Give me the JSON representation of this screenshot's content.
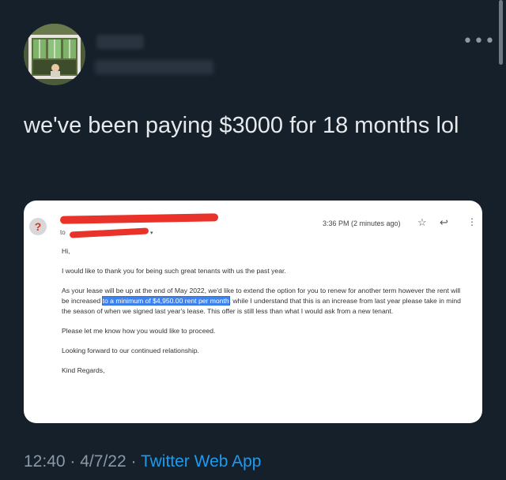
{
  "tweet": {
    "text": "we've been paying $3000 for 18 months lol",
    "more_icon": "more-horizontal-icon",
    "timestamp_time": "12:40",
    "separator": "·",
    "timestamp_date": "4/7/22",
    "source": "Twitter Web App"
  },
  "email": {
    "to_label": "to",
    "time": "3:36 PM (2 minutes ago)",
    "greeting": "Hi,",
    "para1": "I would like to thank you for being such great tenants with us the past year.",
    "para2_before": "As your lease will be up at the end of May 2022, we'd like to extend the option for you to renew for another term however the rent will be increased ",
    "para2_highlight": "to a minimum of $4,950.00 rent per month",
    "para2_after": ", while I understand that this is an increase from last year please take in mind the season of when we signed last year's lease.  This offer is still less than what I would ask from a new tenant.",
    "para3": "Please let me know how you would like to proceed.",
    "para4": "Looking forward to our continued relationship.",
    "closing": "Kind Regards,",
    "unknown_sender_glyph": "?",
    "icons": [
      "star-icon",
      "reply-icon",
      "kebab-icon"
    ],
    "redaction_color": "#e8322a",
    "highlight_color": "#3f83ef"
  },
  "colors": {
    "background": "#15202b",
    "text": "#e7e9ea",
    "secondary": "#8b98a5",
    "link": "#1d9bf0"
  }
}
